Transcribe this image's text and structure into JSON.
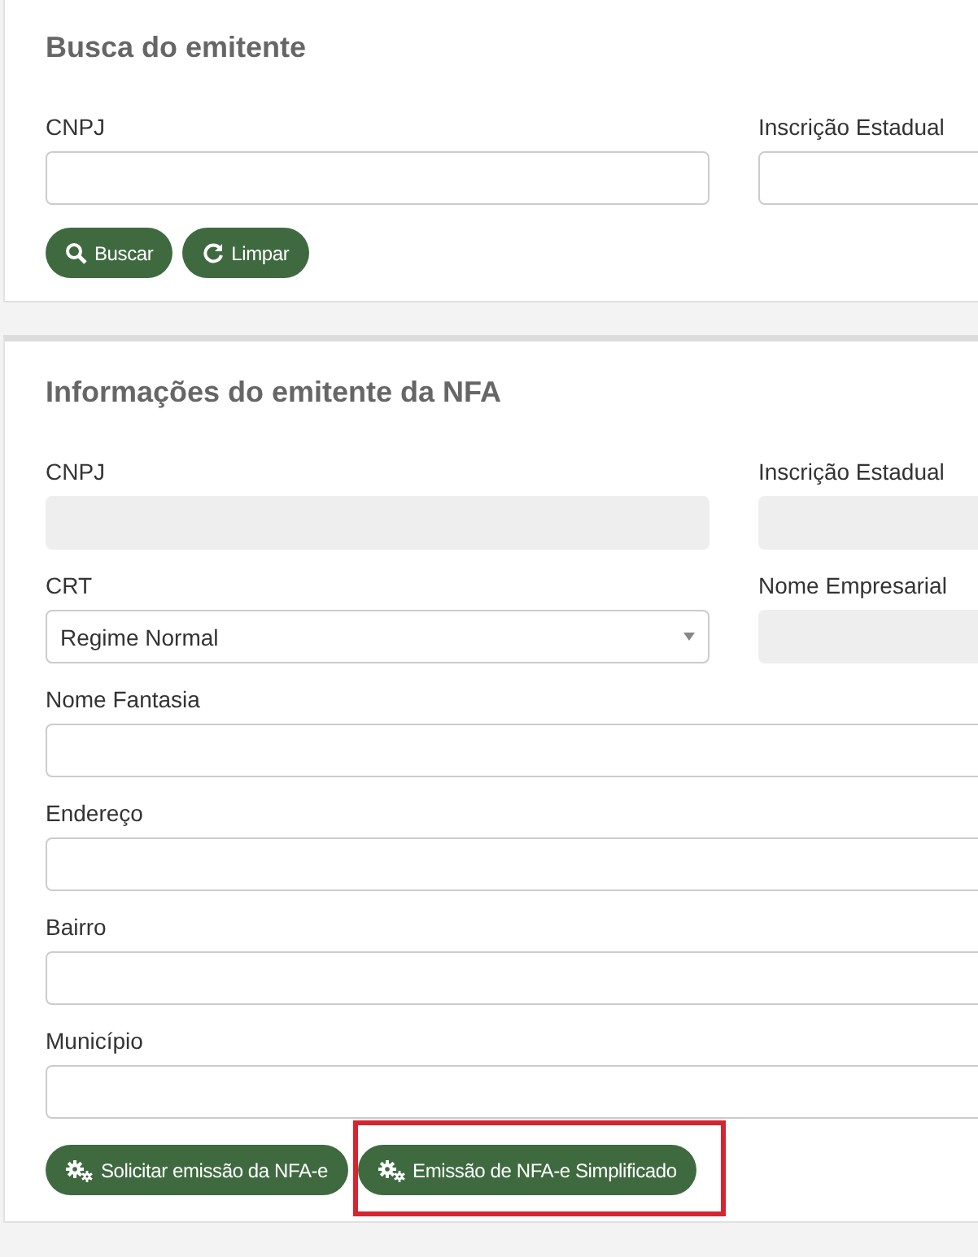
{
  "sections": [
    {
      "title": "Busca do emitente",
      "rows": [
        [
          {
            "label": "CNPJ",
            "kind": "text",
            "disabled": false
          },
          {
            "label": "Inscrição Estadual",
            "kind": "text",
            "disabled": false
          }
        ]
      ],
      "buttons": [
        {
          "label": "Buscar",
          "kind": "search",
          "highlighted": false
        },
        {
          "label": "Limpar",
          "kind": "refresh",
          "highlighted": false
        }
      ]
    },
    {
      "title": "Informações do emitente da NFA",
      "rows": [
        [
          {
            "label": "CNPJ",
            "kind": "text",
            "disabled": true
          },
          {
            "label": "Inscrição Estadual",
            "kind": "text",
            "disabled": true
          }
        ],
        [
          {
            "label": "CRT",
            "kind": "select",
            "value": "Regime Normal"
          },
          {
            "label": "Nome Empresarial",
            "kind": "text",
            "disabled": true
          }
        ],
        [
          {
            "label": "Nome Fantasia",
            "kind": "text",
            "disabled": false
          }
        ],
        [
          {
            "label": "Endereço",
            "kind": "text",
            "disabled": false
          }
        ],
        [
          {
            "label": "Bairro",
            "kind": "text",
            "disabled": false
          }
        ],
        [
          {
            "label": "Município",
            "kind": "text",
            "disabled": false
          }
        ]
      ],
      "buttons": [
        {
          "label": "Solicitar emissão da NFA-e",
          "kind": "gears",
          "highlighted": false
        },
        {
          "label": "Emissão de NFA-e Simplificado",
          "kind": "gears",
          "highlighted": true
        }
      ]
    }
  ]
}
